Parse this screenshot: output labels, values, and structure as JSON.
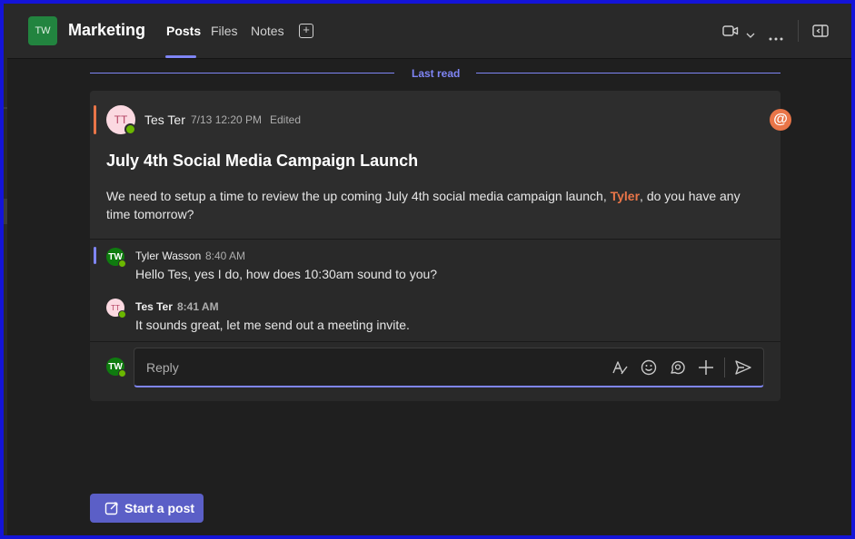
{
  "header": {
    "team_avatar_initials": "TW",
    "channel_name": "Marketing",
    "tabs": [
      {
        "label": "Posts",
        "active": true
      },
      {
        "label": "Files",
        "active": false
      },
      {
        "label": "Notes",
        "active": false
      }
    ],
    "add_tab_icon": "plus-square-icon",
    "icons": [
      "video-camera-icon",
      "chevron-down-icon",
      "more-options-icon",
      "open-pane-icon"
    ]
  },
  "last_read_label": "Last read",
  "post": {
    "author_initials": "TT",
    "author": "Tes Ter",
    "timestamp": "7/13 12:20 PM",
    "edited_label": "Edited",
    "title": "July 4th Social Media Campaign Launch",
    "body_before": "We need to setup a time to review the up coming July 4th social media campaign launch, ",
    "mention": "Tyler",
    "body_after": ", do you have any time tomorrow?",
    "mention_badge": "@"
  },
  "replies": [
    {
      "initials": "TW",
      "author": "Tyler Wasson",
      "time": "8:40 AM",
      "text": "Hello Tes, yes I do, how does 10:30am sound to you?"
    },
    {
      "initials": "TT",
      "author": "Tes Ter",
      "time": "8:41 AM",
      "text": "It sounds great, let me send out a meeting invite."
    }
  ],
  "composer": {
    "avatar_initials": "TW",
    "placeholder": "Reply",
    "icons": [
      "format-icon",
      "emoji-icon",
      "loop-icon",
      "plus-icon",
      "send-icon"
    ]
  },
  "start_post_label": "Start a post",
  "colors": {
    "accent": "#7f85f5",
    "brand_button": "#5b5fc7",
    "mention": "#e97548",
    "team_avatar": "#22843f",
    "presence": "#6bb700"
  }
}
